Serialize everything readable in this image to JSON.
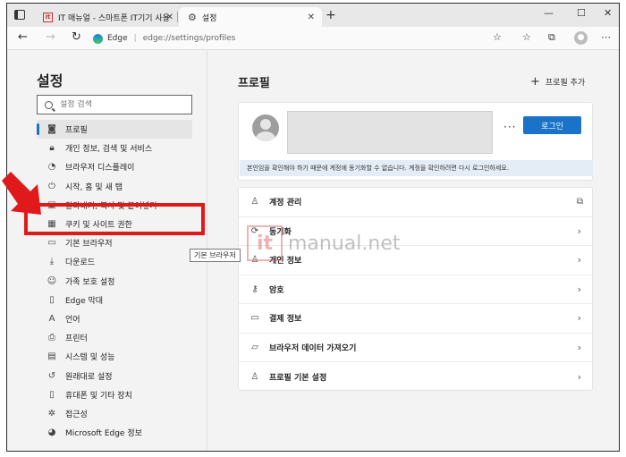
{
  "browser": {
    "tabs": [
      {
        "label": "IT 매뉴얼 - 스마트폰 IT기기 사용",
        "close": "✕",
        "favicon": "it"
      },
      {
        "label": "설정",
        "close": "✕",
        "favicon": "gear-icon"
      }
    ],
    "new_tab": "+",
    "window_controls": {
      "minimize": "—",
      "maximize": "☐",
      "close": "✕"
    },
    "address": {
      "site": "Edge",
      "separator": "|",
      "url": "edge://settings/profiles"
    }
  },
  "sidebar": {
    "title": "설정",
    "search_placeholder": "설정 검색",
    "items": [
      {
        "label": "프로필",
        "icon": "profile-icon",
        "selected": true
      },
      {
        "label": "개인 정보, 검색 및 서비스",
        "icon": "lock-icon"
      },
      {
        "label": "브라우저 디스플레이",
        "icon": "palette-icon"
      },
      {
        "label": "시작, 홈 및 새 탭",
        "icon": "power-icon"
      },
      {
        "label": "잘라내기, 복사 및 붙여넣기",
        "icon": "clipboard-icon"
      },
      {
        "label": "쿠키 및 사이트 권한",
        "icon": "cookie-icon"
      },
      {
        "label": "기본 브라우저",
        "icon": "browser-icon"
      },
      {
        "label": "다운로드",
        "icon": "download-icon"
      },
      {
        "label": "가족 보호 설정",
        "icon": "family-icon"
      },
      {
        "label": "Edge 막대",
        "icon": "bar-icon"
      },
      {
        "label": "언어",
        "icon": "language-icon"
      },
      {
        "label": "프린터",
        "icon": "printer-icon"
      },
      {
        "label": "시스템 및 성능",
        "icon": "system-icon"
      },
      {
        "label": "원래대로 설정",
        "icon": "reset-icon"
      },
      {
        "label": "휴대폰 및 기타 장치",
        "icon": "phone-icon"
      },
      {
        "label": "접근성",
        "icon": "accessibility-icon"
      },
      {
        "label": "Microsoft Edge 정보",
        "icon": "edge-icon"
      }
    ]
  },
  "tooltip": "기본 브라우저",
  "main": {
    "title": "프로필",
    "add_profile": "프로필 추가",
    "more": "···",
    "login_button": "로그인",
    "notice": "본인임을 확인해야 하기 때문에 계정에 동기화할 수 없습니다. 계정을 확인하려면 다시 로그인하세요.",
    "menu": [
      {
        "label": "계정 관리",
        "icon": "person-icon",
        "action": "external"
      },
      {
        "label": "동기화",
        "icon": "sync-icon",
        "action": "chevron"
      },
      {
        "label": "개인 정보",
        "icon": "person-info-icon",
        "action": "chevron"
      },
      {
        "label": "암호",
        "icon": "key-icon",
        "action": "chevron"
      },
      {
        "label": "결제 정보",
        "icon": "card-icon",
        "action": "chevron"
      },
      {
        "label": "브라우저 데이터 가져오기",
        "icon": "import-icon",
        "action": "chevron"
      },
      {
        "label": "프로필 기본 설정",
        "icon": "profile-settings-icon",
        "action": "chevron"
      }
    ]
  },
  "watermark": {
    "logo": "it",
    "text": "manual.net"
  },
  "colors": {
    "accent": "#1a73c8",
    "highlight": "#e0191a",
    "notice_bg": "#e4edf6"
  }
}
